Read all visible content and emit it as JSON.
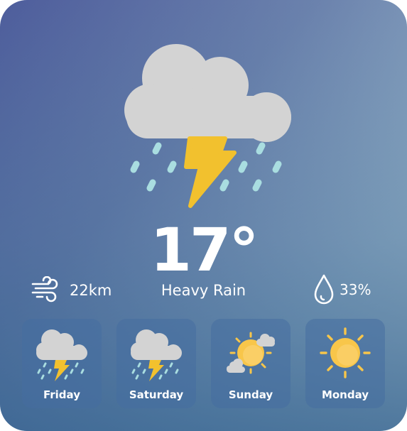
{
  "current": {
    "icon": "thunderstorm-rain-icon",
    "temperature": "17°",
    "condition": "Heavy Rain",
    "wind": "22km",
    "wind_icon": "wind-icon",
    "humidity": "33%",
    "humidity_icon": "droplet-icon"
  },
  "forecast": [
    {
      "day": "Friday",
      "icon": "thunderstorm-rain-icon"
    },
    {
      "day": "Saturday",
      "icon": "thunderstorm-rain-icon"
    },
    {
      "day": "Sunday",
      "icon": "partly-sunny-icon"
    },
    {
      "day": "Monday",
      "icon": "sun-icon"
    }
  ],
  "colors": {
    "cloud": "#d3d3d3",
    "bolt": "#f2c12e",
    "rain": "#a9dde0",
    "sun": "#f8c64a",
    "tile": "#466ea0"
  }
}
